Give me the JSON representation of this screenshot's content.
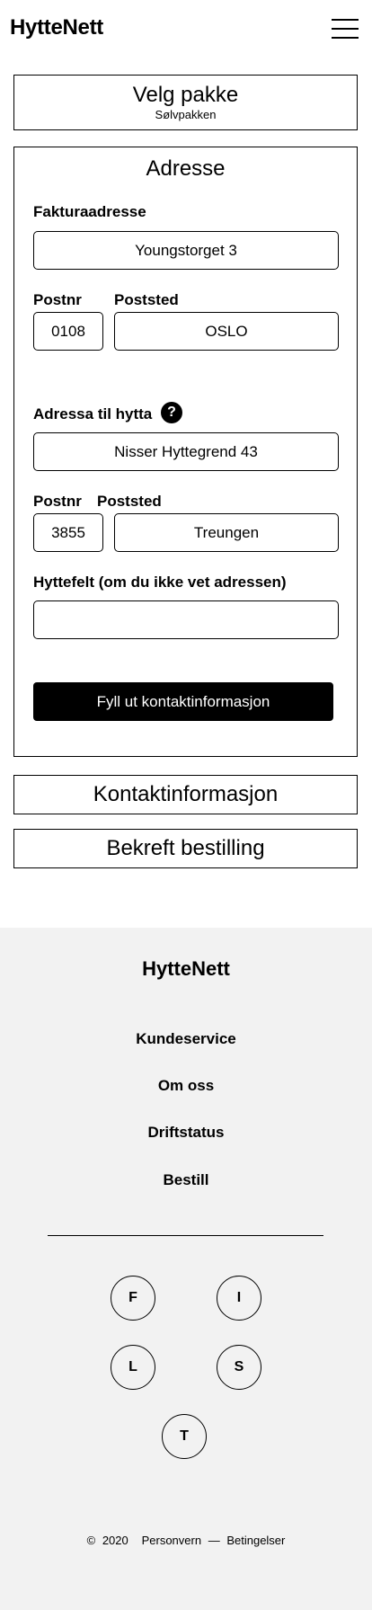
{
  "header": {
    "logo": "HytteNett",
    "menu_icon": "hamburger-menu-icon"
  },
  "steps": {
    "package": {
      "title": "Velg pakke",
      "selected": "Sølvpakken"
    },
    "address": {
      "title": "Adresse",
      "billing": {
        "label": "Fakturaadresse",
        "value": "Youngstorget 3",
        "postnr_label": "Postnr",
        "postnr_value": "0108",
        "poststed_label": "Poststed",
        "poststed_value": "OSLO"
      },
      "cabin": {
        "label": "Adressa til hytta",
        "help_symbol": "?",
        "value": "Nisser Hyttegrend 43",
        "postnr_label": "Postnr",
        "postnr_value": "3855",
        "poststed_label": "Poststed",
        "poststed_value": "Treungen"
      },
      "cabin_field": {
        "label": "Hyttefelt (om du ikke vet adressen)",
        "value": ""
      },
      "submit_label": "Fyll ut kontaktinformasjon"
    },
    "contact": {
      "title": "Kontaktinformasjon"
    },
    "confirm": {
      "title": "Bekreft bestilling"
    }
  },
  "footer": {
    "logo": "HytteNett",
    "links": [
      "Kundeservice",
      "Om oss",
      "Driftstatus",
      "Bestill"
    ],
    "social": [
      "F",
      "I",
      "L",
      "S",
      "T"
    ],
    "copyright_symbol": "©",
    "year": "2020",
    "privacy": "Personvern",
    "separator": "—",
    "terms": "Betingelser",
    "background": "#f2f2f2"
  }
}
